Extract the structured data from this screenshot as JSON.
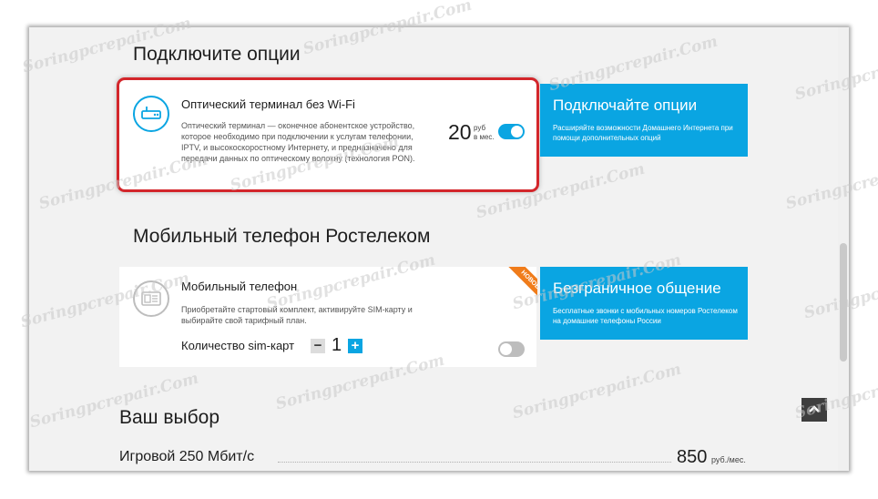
{
  "colors": {
    "accent": "#0aa5e2",
    "selection_border": "#d3262b",
    "badge": "#f07c1a",
    "toggle_off": "#bdbdbd",
    "icon_inactive": "#bdbdbd"
  },
  "options_section": {
    "heading": "Подключите опции",
    "card": {
      "icon": "router-icon",
      "title": "Оптический терминал без Wi-Fi",
      "description": "Оптический терминал — оконечное абонентское устройство, которое необходимо при подключении к услугам телефонии, IPTV, и высокоскоростному Интернету, и предназначено для передачи данных по оптическому волокну (технология PON).",
      "price": "20",
      "price_unit_line1": "руб",
      "price_unit_line2": "в мес.",
      "toggle_on": true
    },
    "promo": {
      "title": "Подключайте опции",
      "text": "Расширяйте возможности Домашнего Интернета при помощи дополнительных опций"
    }
  },
  "mobile_section": {
    "heading": "Мобильный телефон Ростелеком",
    "card": {
      "icon": "sim-card-icon",
      "title": "Мобильный телефон",
      "description": "Приобретайте стартовый комплект, активируйте SIM-карту и выбирайте свой тарифный план.",
      "badge": "НОВОЕ",
      "quantity_label": "Количество sim-карт",
      "quantity_minus": "−",
      "quantity_value": "1",
      "quantity_plus": "+",
      "toggle_on": false
    },
    "promo": {
      "title": "Безграничное общение",
      "text": "Бесплатные звонки с мобильных номеров Ростелеком на домашние телефоны России"
    }
  },
  "summary": {
    "heading": "Ваш выбор",
    "item_name": "Игровой 250 Мбит/с",
    "item_price": "850",
    "item_price_unit": "руб./мес."
  },
  "scroll_top": {
    "icon": "chevron-up-icon"
  },
  "watermark": "Soringpcrepair.Com"
}
